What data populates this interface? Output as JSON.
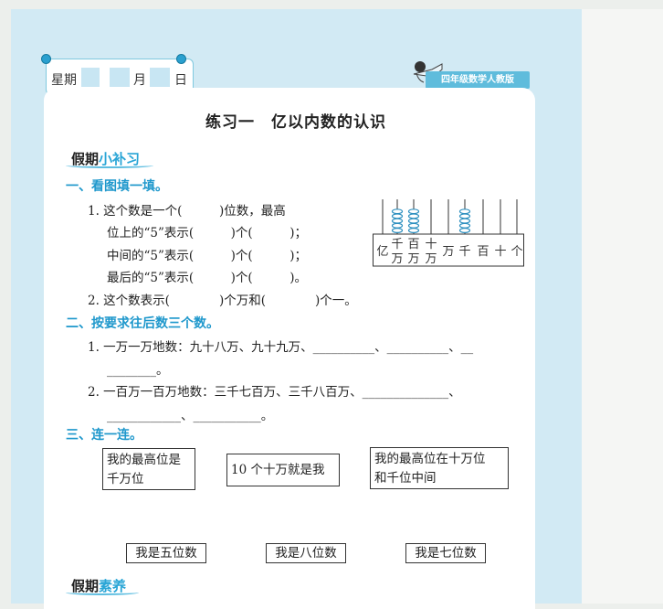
{
  "header": {
    "weekday_label": "星期",
    "month_label": "月",
    "day_label": "日",
    "grade_badge": "四年级数学人教版"
  },
  "title": "练习一　亿以内数的认识",
  "section_top": {
    "part_a": "假期",
    "part_b": "小补习"
  },
  "q1": {
    "heading": "一、看图填一填。",
    "lines": [
      "1. 这个数是一个(　　　)位数，最高",
      "位上的“5”表示(　　　)个(　　　)；",
      "中间的“5”表示(　　　)个(　　　)；",
      "最后的“5”表示(　　　)个(　　　)。",
      "2. 这个数表示(　　　　)个万和(　　　　)个一。"
    ],
    "abacus_labels": [
      "亿",
      "千万",
      "百万",
      "十万",
      "万",
      "千",
      "百",
      "十",
      "个"
    ]
  },
  "q2": {
    "heading": "二、按要求往后数三个数。",
    "lines": [
      "1. 一万一万地数：九十八万、九十九万、__________、__________、__",
      "________。",
      "2. 一百万一百万地数：三千七百万、三千八百万、______________、",
      "____________、___________。"
    ]
  },
  "q3": {
    "heading": "三、连一连。",
    "top_boxes": [
      "我的最高位是\n千万位",
      "10 个十万就是我",
      "我的最高位在十万位\n和千位中间"
    ],
    "bottom_boxes": [
      "我是五位数",
      "我是八位数",
      "我是七位数"
    ]
  },
  "section_bottom": {
    "part_a": "假期",
    "part_b": "素养"
  },
  "colors": {
    "accent": "#29a5d6",
    "sheet": "#d2eaf4",
    "bead": "#2c8fbf"
  }
}
